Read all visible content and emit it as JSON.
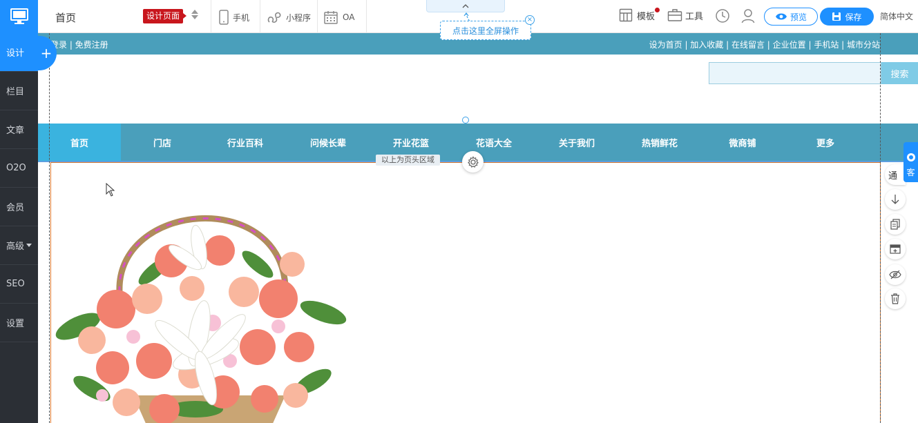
{
  "sidebar": {
    "items": [
      {
        "label": "设计",
        "active": true
      },
      {
        "label": "栏目"
      },
      {
        "label": "文章"
      },
      {
        "label": "O2O"
      },
      {
        "label": "会员"
      },
      {
        "label": "高级",
        "has_dropdown": true
      },
      {
        "label": "SEO"
      },
      {
        "label": "设置"
      }
    ],
    "plus_label": "+"
  },
  "toolbar": {
    "page_name": "首页",
    "page_badge": "设计页面",
    "tools": [
      "手机",
      "小程序",
      "OA"
    ],
    "fullscreen_tip": "点击这里全屏操作",
    "right": {
      "template": "模板",
      "tools": "工具",
      "preview": "预览",
      "save": "保存",
      "language": "简体中文"
    }
  },
  "site": {
    "topbar_left": "登录 | 免费注册",
    "topbar_right": "设为首页 | 加入收藏 | 在线留言 | 企业位置 | 手机站 | 城市分站",
    "search_button": "搜索",
    "nav": [
      "首页",
      "门店",
      "行业百科",
      "问候长辈",
      "开业花篮",
      "花语大全",
      "关于我们",
      "热销鲜花",
      "微商铺",
      "更多"
    ],
    "header_region_label": "以上为页头区域"
  },
  "rail": {
    "tongue_label": "通",
    "service_label": "客"
  },
  "colors": {
    "sidebar_bg": "#2b2f35",
    "accent": "#1e90ff",
    "site_primary": "#4a9fbb",
    "nav_active": "#3ab3df",
    "badge_red": "#c8161d"
  }
}
